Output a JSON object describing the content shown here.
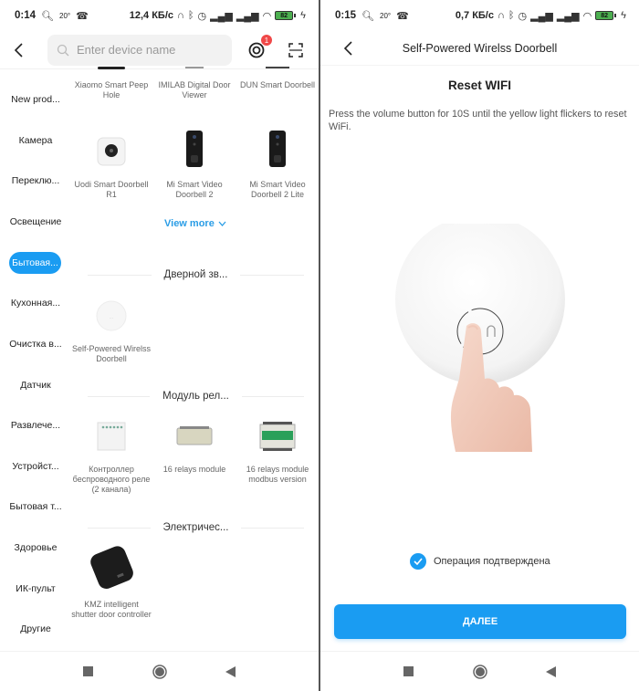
{
  "left_screen": {
    "status_bar": {
      "time": "0:14",
      "temperature": "20°",
      "network_speed": "12,4 КБ/с",
      "battery": "82"
    },
    "header": {
      "search_placeholder": "Enter device name",
      "notification_count": "1"
    },
    "sidebar": {
      "active_index": 4,
      "items": [
        {
          "label": "New prod..."
        },
        {
          "label": "Камера"
        },
        {
          "label": "Переклю..."
        },
        {
          "label": "Освещение"
        },
        {
          "label": "Бытовая..."
        },
        {
          "label": "Кухонная..."
        },
        {
          "label": "Очистка в..."
        },
        {
          "label": "Датчик"
        },
        {
          "label": "Развлече..."
        },
        {
          "label": "Устройст..."
        },
        {
          "label": "Бытовая т..."
        },
        {
          "label": "Здоровье"
        },
        {
          "label": "ИК-пульт"
        },
        {
          "label": "Другие"
        }
      ]
    },
    "content": {
      "top_items": [
        {
          "name": "Xiaomo Smart Peep Hole"
        },
        {
          "name": "IMILAB Digital Door Viewer"
        },
        {
          "name": "DUN Smart Doorbell"
        }
      ],
      "camera_items": [
        {
          "name": "Uodi Smart Doorbell R1"
        },
        {
          "name": "Mi Smart Video Doorbell 2"
        },
        {
          "name": "Mi Smart Video Doorbell 2 Lite"
        }
      ],
      "view_more_label": "View more",
      "sections": [
        {
          "title": "Дверной зв...",
          "items": [
            {
              "name": "Self-Powered Wirelss Doorbell"
            }
          ]
        },
        {
          "title": "Модуль рел...",
          "items": [
            {
              "name": "Контроллер беспроводного реле (2 канала)"
            },
            {
              "name": "16 relays module"
            },
            {
              "name": "16 relays module modbus version"
            }
          ]
        },
        {
          "title": "Электричес...",
          "items": [
            {
              "name": "KMZ intelligent shutter door controller"
            }
          ]
        }
      ]
    }
  },
  "right_screen": {
    "status_bar": {
      "time": "0:15",
      "temperature": "20°",
      "network_speed": "0,7 КБ/с",
      "battery": "82"
    },
    "header": {
      "title": "Self-Powered Wirelss Doorbell"
    },
    "heading": "Reset WIFI",
    "description": "Press the volume button for 10S until the yellow light flickers to reset WiFi.",
    "confirm_label": "Операция подтверждена",
    "confirm_checked": true,
    "next_button_label": "ДАЛЕЕ"
  },
  "colors": {
    "accent": "#1a9cf2",
    "badge": "#f04848",
    "battery": "#4caf50"
  },
  "icons": {
    "back": "chevron-left-icon",
    "search": "search-icon",
    "notification": "notification-target-icon",
    "scan": "scan-icon",
    "view_more_chevron": "chevron-down-icon",
    "check": "check-circle-icon",
    "nav_recents": "square-icon",
    "nav_home": "circle-icon",
    "nav_back": "triangle-back-icon"
  }
}
